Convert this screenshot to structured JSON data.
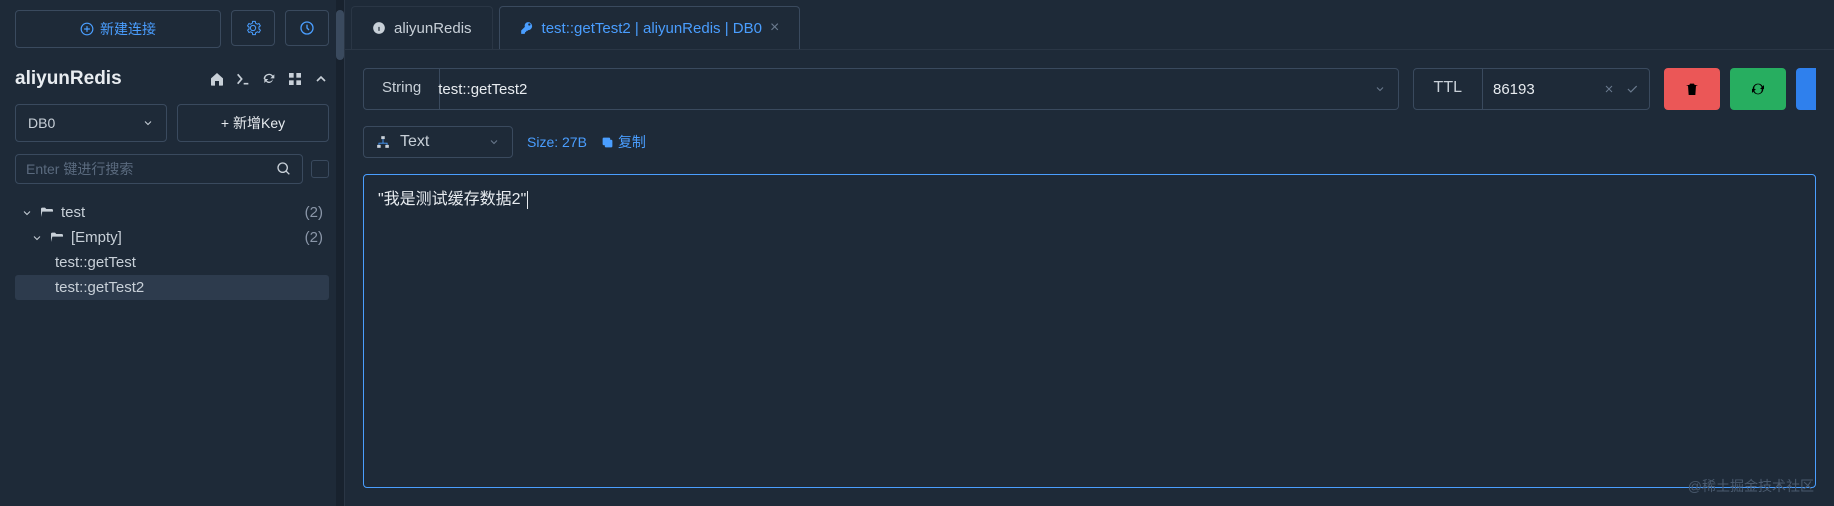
{
  "sidebar": {
    "new_connection": "新建连接",
    "connection_name": "aliyunRedis",
    "db_selected": "DB0",
    "add_key": "新增Key",
    "search_placeholder": "Enter 键进行搜索",
    "tree": {
      "root": {
        "label": "test",
        "count": "(2)"
      },
      "folder": {
        "label": "[Empty]",
        "count": "(2)"
      },
      "key1": "test::getTest",
      "key2": "test::getTest2"
    }
  },
  "tabs": {
    "tab1": "aliyunRedis",
    "tab2": "test::getTest2 | aliyunRedis | DB0"
  },
  "key_detail": {
    "type": "String",
    "key_name": "test::getTest2",
    "ttl_label": "TTL",
    "ttl_value": "86193",
    "format": "Text",
    "size": "Size: 27B",
    "copy": "复制",
    "value": "\"我是测试缓存数据2\""
  },
  "watermark": "@稀土掘金技术社区"
}
